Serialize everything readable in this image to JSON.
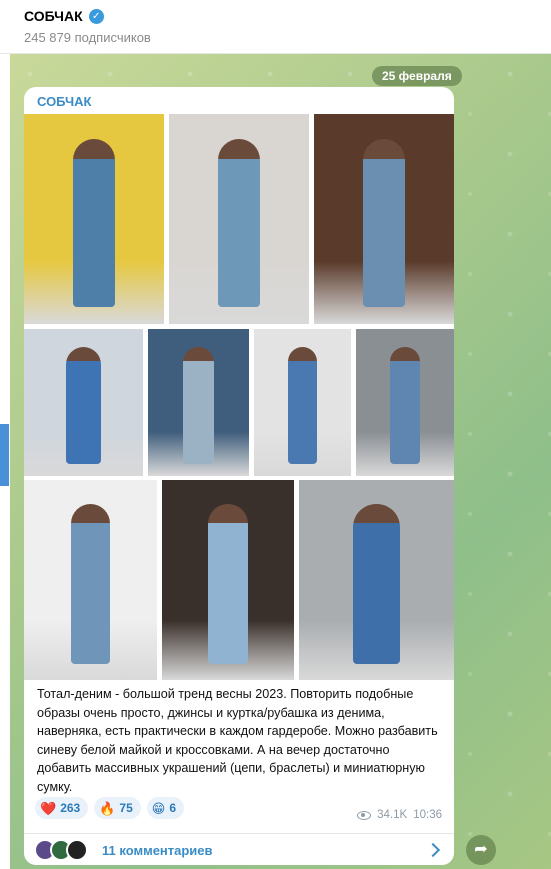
{
  "channel": {
    "title": "СОБЧАК",
    "subscribers": "245 879 подписчиков",
    "verified_icon": "verified-badge-icon"
  },
  "chat": {
    "date_pill": "25 февраля"
  },
  "post": {
    "author": "СОБЧАК",
    "photos": [
      {
        "name": "photo-runway-denim",
        "bg": "#e6c840",
        "fig": "#4d7fa8"
      },
      {
        "name": "photo-studio-denim",
        "bg": "#d9d6d2",
        "fig": "#6e98b8"
      },
      {
        "name": "photo-dark-denim",
        "bg": "#5a3a2a",
        "fig": "#6b8fb0"
      },
      {
        "name": "photo-street-blue-coat",
        "bg": "#cfd6de",
        "fig": "#3e74b4"
      },
      {
        "name": "photo-curly-hair-shirt",
        "bg": "#3f5e7d",
        "fig": "#9bb2c4"
      },
      {
        "name": "photo-white-tank",
        "bg": "#e3e3e3",
        "fig": "#4a78b0"
      },
      {
        "name": "photo-street-duo",
        "bg": "#8a8f94",
        "fig": "#5e86b0"
      },
      {
        "name": "photo-oversized-suit",
        "bg": "#efefef",
        "fig": "#6f95b8"
      },
      {
        "name": "photo-dark-studio-denim",
        "bg": "#3a302b",
        "fig": "#8fb3d0"
      },
      {
        "name": "photo-shutter-wall",
        "bg": "#a9adb0",
        "fig": "#3e6fa8"
      }
    ],
    "text": "Тотал-деним - большой тренд весны 2023. Повторить подобные образы очень просто, джинсы и куртка/рубашка из денима, наверняка, есть практически в каждом гардеробе. Можно разбавить синеву белой майкой и кроссовками. А на вечер достаточно добавить массивных украшений (цепи, браслеты) и миниатюрную сумку.",
    "reactions": [
      {
        "emoji": "❤️",
        "icon": "heart-icon",
        "count": "263"
      },
      {
        "emoji": "🔥",
        "icon": "fire-icon",
        "count": "75"
      },
      {
        "emoji": "😁",
        "icon": "grin-icon",
        "count": "6"
      }
    ],
    "views": "34.1K",
    "time": "10:36",
    "comments_label": "11 комментариев",
    "avatar_colors": [
      "#5b4a8a",
      "#2f6b3e",
      "#222222"
    ]
  },
  "colors": {
    "accent": "#3a8cc6",
    "reaction_bg": "#e9f1fa"
  }
}
